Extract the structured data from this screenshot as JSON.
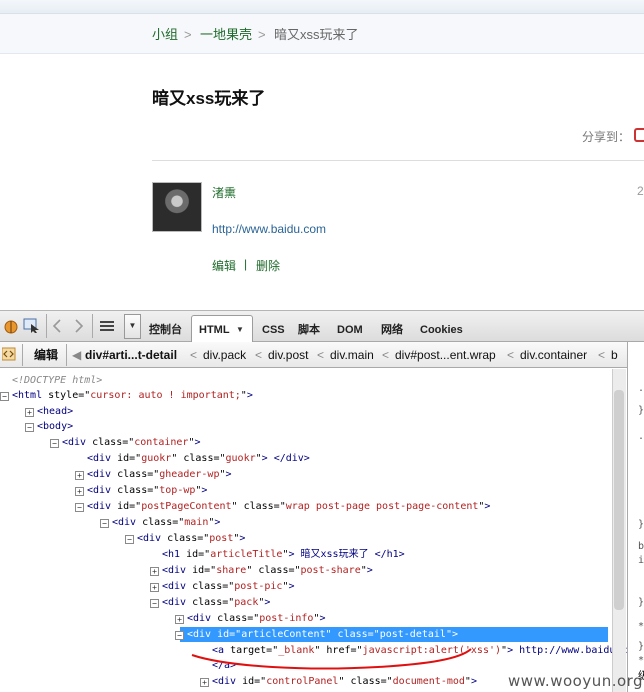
{
  "breadcrumb": {
    "items": [
      "小组",
      "一地果壳"
    ],
    "separator": ">",
    "current": "暗又xss玩来了"
  },
  "post": {
    "title": "暗又xss玩来了",
    "share_label": "分享到：",
    "author": "渚熏",
    "date_fragment": "2",
    "body_link": "http://www.baidu.com",
    "actions": {
      "edit": "编辑",
      "sep": "|",
      "delete": "删除"
    }
  },
  "firebug": {
    "toolbar": {
      "console": "控制台",
      "html": "HTML",
      "css": "CSS",
      "script": "脚本",
      "dom": "DOM",
      "net": "网络",
      "cookies": "Cookies"
    },
    "crumb_edit": "编辑",
    "crumbs": [
      "div#arti...t-detail",
      "div.pack",
      "div.post",
      "div.main",
      "div#post...ent.wrap",
      "div.container",
      "b"
    ],
    "crumb_sep": "<",
    "tree": [
      {
        "text": "<!DOCTYPE html>"
      },
      {
        "pre": "<html ",
        "attrs": [
          [
            "style",
            "cursor: auto ! important;"
          ]
        ],
        "post": ">"
      },
      {
        "pre": "<head>"
      },
      {
        "pre": "<body>"
      },
      {
        "pre": "<div ",
        "attrs": [
          [
            "class",
            "container"
          ]
        ],
        "post": ">"
      },
      {
        "pre": "<div ",
        "attrs": [
          [
            "id",
            "guokr"
          ],
          [
            "class",
            "guokr"
          ]
        ],
        "post": "> </div>"
      },
      {
        "pre": "<div ",
        "attrs": [
          [
            "class",
            "gheader-wp"
          ]
        ],
        "post": ">"
      },
      {
        "pre": "<div ",
        "attrs": [
          [
            "class",
            "top-wp"
          ]
        ],
        "post": ">"
      },
      {
        "pre": "<div ",
        "attrs": [
          [
            "id",
            "postPageContent"
          ],
          [
            "class",
            "wrap post-page post-page-content"
          ]
        ],
        "post": ">"
      },
      {
        "pre": "<div ",
        "attrs": [
          [
            "class",
            "main"
          ]
        ],
        "post": ">"
      },
      {
        "pre": "<div ",
        "attrs": [
          [
            "class",
            "post"
          ]
        ],
        "post": ">"
      },
      {
        "pre": "<h1 ",
        "attrs": [
          [
            "id",
            "articleTitle"
          ]
        ],
        "post": "> 暗又xss玩来了 </h1>"
      },
      {
        "pre": "<div ",
        "attrs": [
          [
            "id",
            "share"
          ],
          [
            "class",
            "post-share"
          ]
        ],
        "post": ">"
      },
      {
        "pre": "<div ",
        "attrs": [
          [
            "class",
            "post-pic"
          ]
        ],
        "post": ">"
      },
      {
        "pre": "<div ",
        "attrs": [
          [
            "class",
            "pack"
          ]
        ],
        "post": ">"
      },
      {
        "pre": "<div ",
        "attrs": [
          [
            "class",
            "post-info"
          ]
        ],
        "post": ">"
      },
      {
        "pre": "<div ",
        "attrs": [
          [
            "id",
            "articleContent"
          ],
          [
            "class",
            "post-detail"
          ]
        ],
        "post": ">"
      },
      {
        "pre": "<a ",
        "attrs": [
          [
            "target",
            "_blank"
          ],
          [
            "href",
            "javascript:alert('xss')"
          ]
        ],
        "post": "> http://www.baidu.com"
      },
      {
        "pre": "</a>"
      },
      {
        "pre": "<div ",
        "attrs": [
          [
            "id",
            "controlPanel"
          ],
          [
            "class",
            "document-mod"
          ]
        ],
        "post": ">"
      }
    ],
    "side_chars": [
      ".",
      "}",
      ".",
      "}",
      "b",
      "i",
      "}",
      "*",
      "}",
      "*",
      "级"
    ]
  },
  "watermark": "www.wooyun.org"
}
